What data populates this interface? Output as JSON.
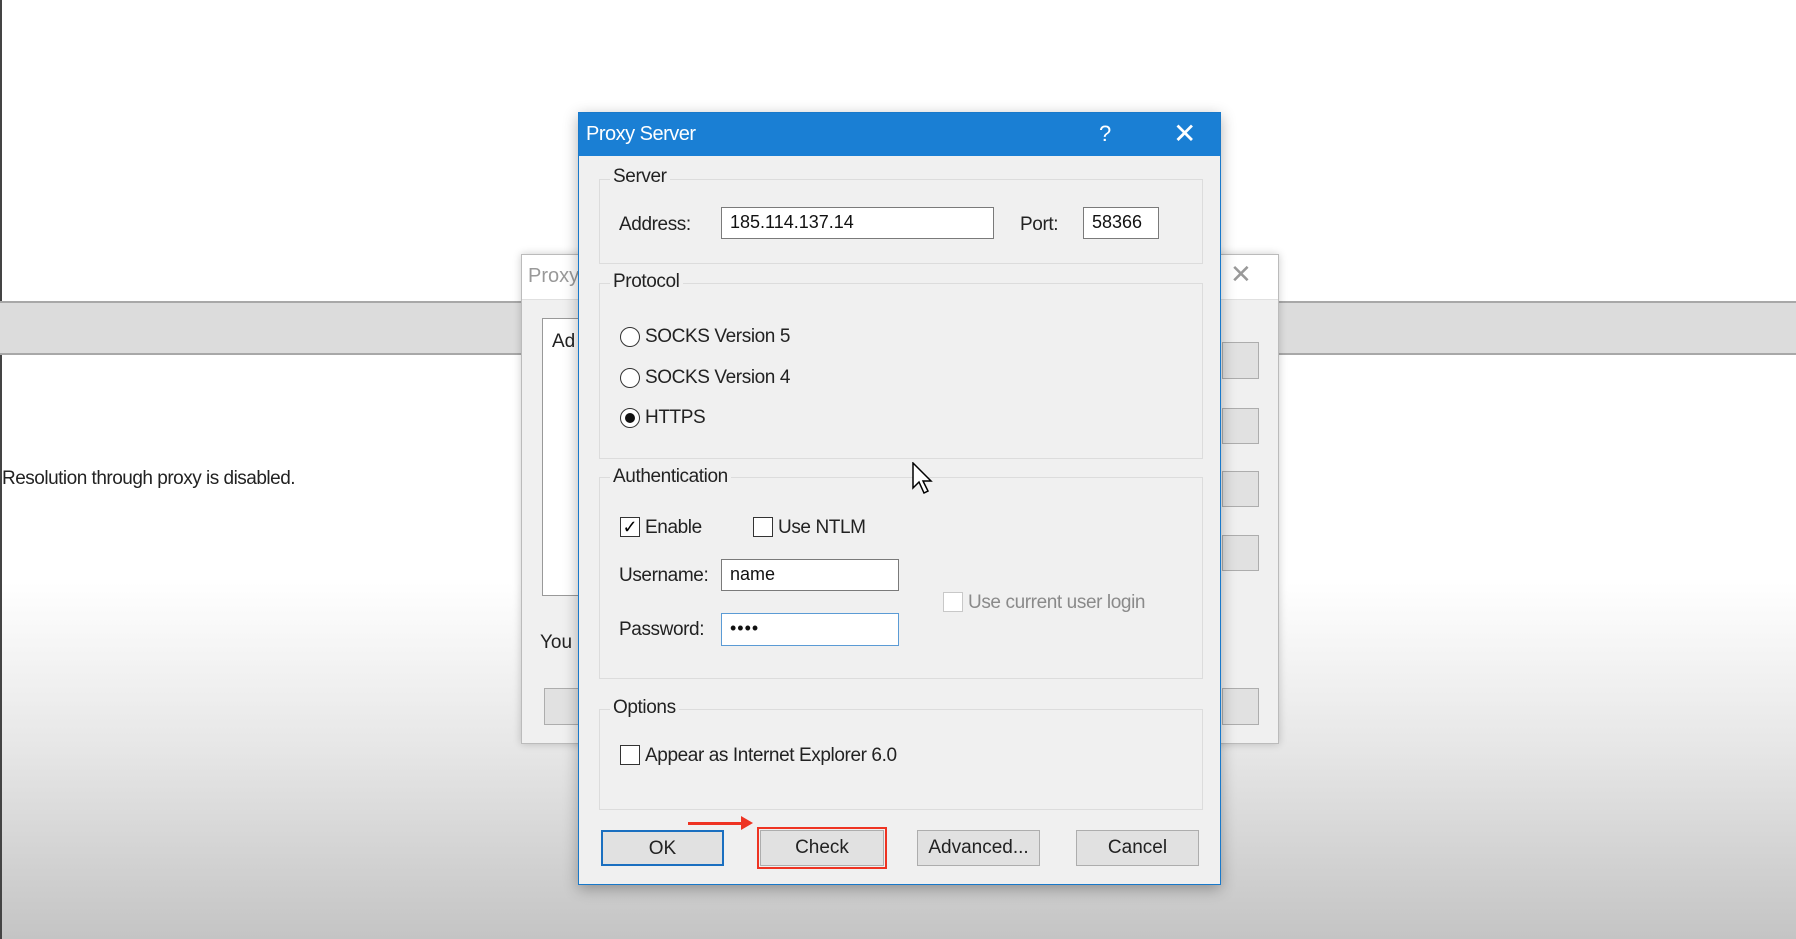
{
  "background": {
    "status_text": "Resolution through proxy is disabled.",
    "dialog_title_fragment": "Proxy",
    "list_fragment": "Ad",
    "note_fragment": "You"
  },
  "dialog": {
    "title": "Proxy Server",
    "help_label": "?",
    "close_label": "✕",
    "server": {
      "legend": "Server",
      "address_label": "Address:",
      "address_value": "185.114.137.14",
      "port_label": "Port:",
      "port_value": "58366"
    },
    "protocol": {
      "legend": "Protocol",
      "options": [
        {
          "label": "SOCKS Version 5",
          "selected": false
        },
        {
          "label": "SOCKS Version 4",
          "selected": false
        },
        {
          "label": "HTTPS",
          "selected": true
        }
      ]
    },
    "authentication": {
      "legend": "Authentication",
      "enable_label": "Enable",
      "enable_checked": true,
      "ntlm_label": "Use NTLM",
      "ntlm_checked": false,
      "username_label": "Username:",
      "username_value": "name",
      "password_label": "Password:",
      "password_value": "••••",
      "current_user_label": "Use current user login",
      "current_user_checked": false
    },
    "options": {
      "legend": "Options",
      "ie6_label": "Appear as Internet Explorer 6.0",
      "ie6_checked": false
    },
    "buttons": {
      "ok": "OK",
      "check": "Check",
      "advanced": "Advanced...",
      "cancel": "Cancel"
    },
    "highlight_color": "#ee3322",
    "accent_color": "#1a7fd4"
  }
}
